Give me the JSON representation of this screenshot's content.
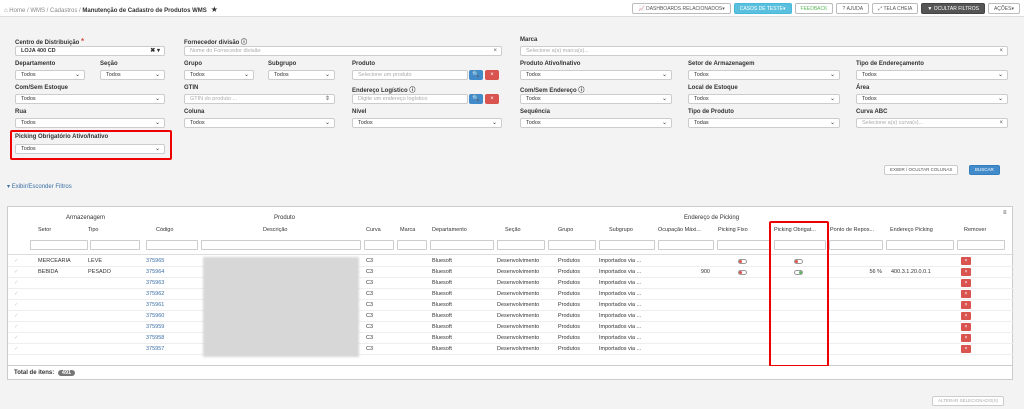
{
  "breadcrumb": {
    "home": "Home",
    "wms": "WMS",
    "cad": "Cadastros",
    "page": "Manutenção de Cadastro de Produtos WMS"
  },
  "topbar": {
    "dash": "DASHBOARDS RELACIONADOS",
    "casos": "CASOS DE TESTE",
    "feedback": "FEEDBACK",
    "ajuda": "AJUDA",
    "tela": "TELA CHEIA",
    "ocultar": "OCULTAR FILTROS",
    "acoes": "AÇÕES"
  },
  "filters": {
    "cd_label": "Centro de Distribuição",
    "cd_value": "LOJA 400 CD",
    "forn_label": "Fornecedor divisão",
    "forn_ph": "Nome do Fornecedor divisão",
    "marca_label": "Marca",
    "marca_ph": "Selecione a(s) marca(s)...",
    "dep_label": "Departamento",
    "dep_value": "Todos",
    "sec_label": "Seção",
    "sec_value": "Todos",
    "grupo_label": "Grupo",
    "grupo_value": "Todos",
    "subg_label": "Subgrupo",
    "subg_value": "Todos",
    "prod_label": "Produto",
    "prod_ph": "Selecione um produto",
    "ativo_label": "Produto Ativo/Inativo",
    "ativo_value": "Todos",
    "setor_label": "Setor de Armazenagem",
    "setor_value": "Todos",
    "tipoend_label": "Tipo de Endereçamento",
    "tipoend_value": "Todos",
    "comsem_label": "Com/Sem Estoque",
    "comsem_value": "Todos",
    "gtin_label": "GTIN",
    "gtin_ph": "GTIN do produto ...",
    "endlog_label": "Endereço Logístico",
    "endlog_ph": "Digite um endereço logístico",
    "comsemend_label": "Com/Sem Endereço",
    "comsemend_value": "Todos",
    "local_label": "Local de Estoque",
    "local_value": "Todos",
    "area_label": "Área",
    "area_value": "Todos",
    "rua_label": "Rua",
    "rua_value": "Todos",
    "coluna_label": "Coluna",
    "coluna_value": "Todos",
    "nivel_label": "Nível",
    "nivel_value": "Todos",
    "seq_label": "Sequência",
    "seq_value": "Todos",
    "tipoprod_label": "Tipo de Produto",
    "tipoprod_value": "Todas",
    "curva_label": "Curva ABC",
    "curva_ph": "Selecione a(s) curva(s)...",
    "picking_label": "Picking Obrigatório Ativo/Inativo",
    "picking_value": "Todos",
    "exibir_btn": "EXIBIR / OCULTAR COLUNAS",
    "buscar_btn": "BUSCAR",
    "toggle": "Exibir/Esconder Filtros"
  },
  "grid": {
    "g_arm": "Armazenagem",
    "g_prod": "Produto",
    "g_end": "Endereço de Picking",
    "cols": {
      "setor": "Setor",
      "tipo": "Tipo",
      "codigo": "Código",
      "descricao": "Descrição",
      "curva": "Curva",
      "marca": "Marca",
      "dep": "Departamento",
      "secao": "Seção",
      "grupo": "Grupo",
      "subgrupo": "Subgrupo",
      "ocup": "Ocupação Máxi...",
      "pfixo": "Picking Fixo",
      "pobrig": "Picking Obrigat...",
      "prepos": "Ponto de Repos...",
      "endpick": "Endereço Picking",
      "remover": "Remover"
    },
    "rows": [
      {
        "setor": "MERCEARIA",
        "tipo": "LEVE",
        "codigo": "375965",
        "curva": "C3",
        "dep": "Bluesoft",
        "secao": "Desenvolvimento",
        "grupo": "Produtos",
        "subgrupo": "Importados via ...",
        "ocup": "",
        "prepos": "",
        "endpick": "",
        "pf": true,
        "po": "red"
      },
      {
        "setor": "BEBIDA",
        "tipo": "PESADO",
        "codigo": "375964",
        "curva": "C3",
        "dep": "Bluesoft",
        "secao": "Desenvolvimento",
        "grupo": "Produtos",
        "subgrupo": "Importados via ...",
        "ocup": "900",
        "prepos": "56 %",
        "endpick": "400.3.1.20.0.0.1",
        "pf": true,
        "po": "grn"
      },
      {
        "setor": "",
        "tipo": "",
        "codigo": "375963",
        "curva": "C3",
        "dep": "Bluesoft",
        "secao": "Desenvolvimento",
        "grupo": "Produtos",
        "subgrupo": "Importados via ...",
        "ocup": "",
        "prepos": "",
        "endpick": ""
      },
      {
        "setor": "",
        "tipo": "",
        "codigo": "375962",
        "curva": "C3",
        "dep": "Bluesoft",
        "secao": "Desenvolvimento",
        "grupo": "Produtos",
        "subgrupo": "Importados via ...",
        "ocup": "",
        "prepos": "",
        "endpick": ""
      },
      {
        "setor": "",
        "tipo": "",
        "codigo": "375961",
        "curva": "C3",
        "dep": "Bluesoft",
        "secao": "Desenvolvimento",
        "grupo": "Produtos",
        "subgrupo": "Importados via ...",
        "ocup": "",
        "prepos": "",
        "endpick": ""
      },
      {
        "setor": "",
        "tipo": "",
        "codigo": "375960",
        "curva": "C3",
        "dep": "Bluesoft",
        "secao": "Desenvolvimento",
        "grupo": "Produtos",
        "subgrupo": "Importados via ...",
        "ocup": "",
        "prepos": "",
        "endpick": ""
      },
      {
        "setor": "",
        "tipo": "",
        "codigo": "375959",
        "curva": "C3",
        "dep": "Bluesoft",
        "secao": "Desenvolvimento",
        "grupo": "Produtos",
        "subgrupo": "Importados via ...",
        "ocup": "",
        "prepos": "",
        "endpick": ""
      },
      {
        "setor": "",
        "tipo": "",
        "codigo": "375958",
        "curva": "C3",
        "dep": "Bluesoft",
        "secao": "Desenvolvimento",
        "grupo": "Produtos",
        "subgrupo": "Importados via ...",
        "ocup": "",
        "prepos": "",
        "endpick": ""
      },
      {
        "setor": "",
        "tipo": "",
        "codigo": "375957",
        "curva": "C3",
        "dep": "Bluesoft",
        "secao": "Desenvolvimento",
        "grupo": "Produtos",
        "subgrupo": "Importados via ...",
        "ocup": "",
        "prepos": "",
        "endpick": ""
      }
    ],
    "total_label": "Total de itens:",
    "total": "491"
  },
  "footer": {
    "alterar": "ALTERAR SELECIONADO(S)"
  }
}
